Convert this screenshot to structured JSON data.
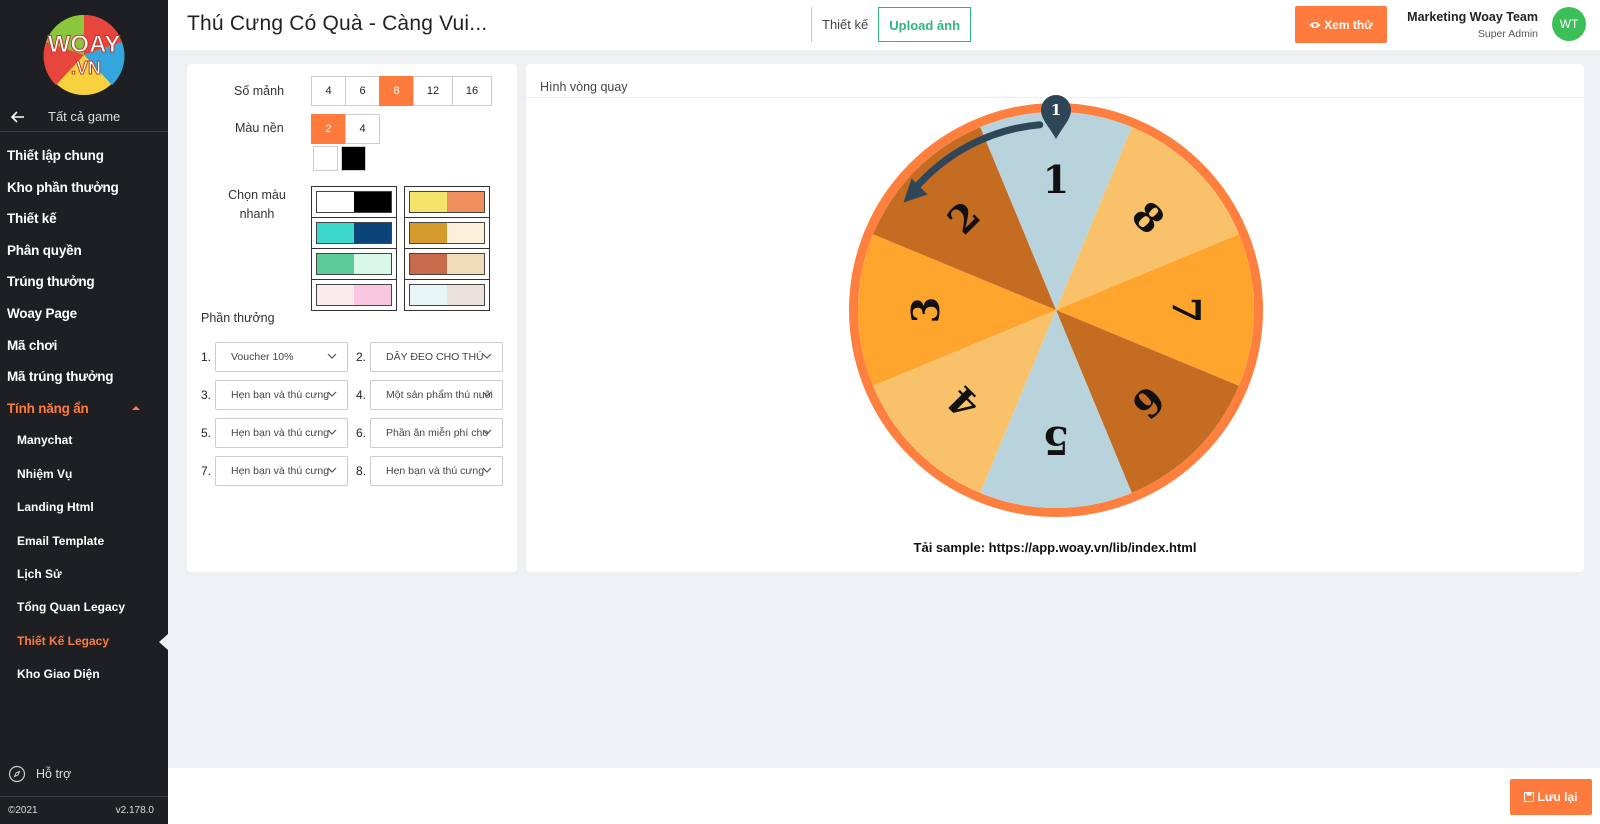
{
  "sidebar": {
    "logo_text": "WOAY.VN",
    "back_label": "Tất cả game",
    "items": [
      {
        "label": "Thiết lập chung"
      },
      {
        "label": "Kho phần thưởng"
      },
      {
        "label": "Thiết kế"
      },
      {
        "label": "Phân quyền"
      },
      {
        "label": "Trúng thưởng"
      },
      {
        "label": "Woay Page"
      },
      {
        "label": "Mã chơi"
      },
      {
        "label": "Mã trúng thưởng"
      },
      {
        "label": "Tính năng ẩn"
      }
    ],
    "sub_items": [
      {
        "label": "Manychat"
      },
      {
        "label": "Nhiệm Vụ"
      },
      {
        "label": "Landing Html"
      },
      {
        "label": "Email Template"
      },
      {
        "label": "Lịch Sử"
      },
      {
        "label": "Tổng Quan Legacy"
      },
      {
        "label": "Thiết Kế Legacy"
      },
      {
        "label": "Kho Giao Diện"
      }
    ],
    "support_label": "Hỗ trợ",
    "copyright": "©2021",
    "version": "v2.178.0"
  },
  "header": {
    "title": "Thú Cưng Có Quà - Càng Vui...",
    "tabs": [
      {
        "label": "Thiết kế"
      },
      {
        "label": "Upload ảnh"
      }
    ],
    "preview_label": "Xem thử",
    "user_name": "Marketing Woay Team",
    "user_role": "Super Admin",
    "avatar_initials": "WT"
  },
  "config": {
    "segments_label": "Số mảnh",
    "segment_options": [
      "4",
      "6",
      "8",
      "12",
      "16"
    ],
    "segment_selected": "8",
    "bg_color_label": "Màu nền",
    "bg_options": [
      "2",
      "4"
    ],
    "bg_selected": "2",
    "bg_colors": [
      "#ffffff",
      "#000000"
    ],
    "quick_color_label": "Chọn màu nhanh",
    "palettes": [
      [
        "#ffffff",
        "#000000"
      ],
      [
        "#f5e46a",
        "#ef8f5e"
      ],
      [
        "#3ad9cc",
        "#0b4478"
      ],
      [
        "#d49a2c",
        "#fbf0d9"
      ],
      [
        "#5ecb9a",
        "#d9f8e9"
      ],
      [
        "#c86a4c",
        "#f1dbb8"
      ],
      [
        "#fbeaea",
        "#f9c7df"
      ],
      [
        "#e7f5f5",
        "#ebe1dc"
      ]
    ],
    "prizes_label": "Phần thưởng",
    "prizes": [
      {
        "num": "1.",
        "value": "Voucher 10%"
      },
      {
        "num": "2.",
        "value": "DÂY ĐEO CHO THÚ"
      },
      {
        "num": "3.",
        "value": "Hẹn bạn và thú cưng"
      },
      {
        "num": "4.",
        "value": "Một sản phẩm thú nuôi"
      },
      {
        "num": "5.",
        "value": "Hẹn bạn và thú cưng"
      },
      {
        "num": "6.",
        "value": "Phần ăn miễn phí cho"
      },
      {
        "num": "7.",
        "value": "Hẹn bạn và thú cưng"
      },
      {
        "num": "8.",
        "value": "Hẹn bạn và thú cưng"
      }
    ]
  },
  "preview": {
    "title": "Hình vòng quay",
    "pointer_label": "1",
    "wheel_segments": [
      {
        "label": "1",
        "color": "#b9d3dc"
      },
      {
        "label": "8",
        "color": "#f9c26a"
      },
      {
        "label": "7",
        "color": "#ffa42c"
      },
      {
        "label": "6",
        "color": "#c46c22"
      },
      {
        "label": "5",
        "color": "#b9d3dc"
      },
      {
        "label": "4",
        "color": "#f9c26a"
      },
      {
        "label": "3",
        "color": "#ffa42c"
      },
      {
        "label": "2",
        "color": "#c46c22"
      }
    ],
    "rim_color": "#ff7f3f",
    "sample_text": "Tải sample: https://app.woay.vn/lib/index.html"
  },
  "footer": {
    "save_label": "Lưu lại"
  },
  "colors": {
    "accent": "#ff7a3d",
    "green": "#2fb67a",
    "sidebar_bg": "#1e1f22"
  }
}
